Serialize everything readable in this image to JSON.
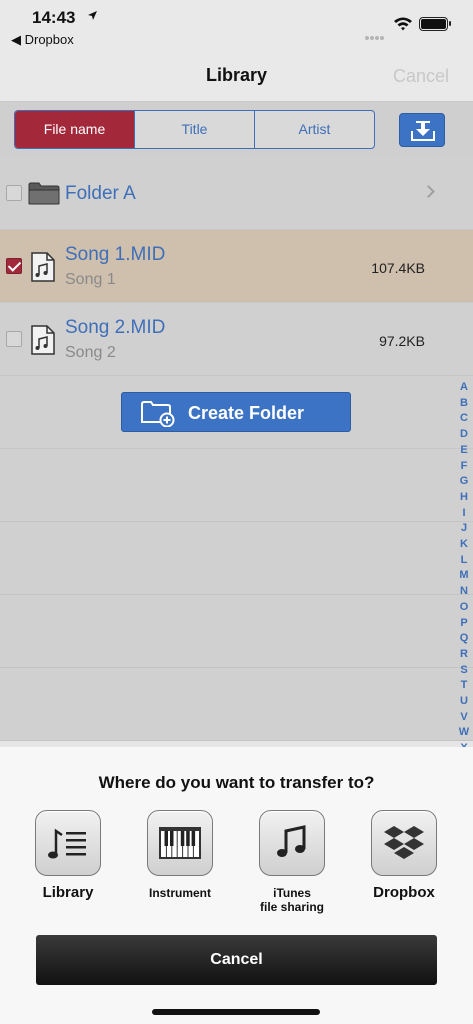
{
  "status": {
    "time": "14:43",
    "back_label": "Dropbox"
  },
  "nav": {
    "title": "Library",
    "cancel": "Cancel"
  },
  "segments": [
    "File name",
    "Title",
    "Artist"
  ],
  "rows": [
    {
      "name": "Folder A"
    },
    {
      "name": "Song 1.MID",
      "sub": "Song 1",
      "size": "107.4KB"
    },
    {
      "name": "Song 2.MID",
      "sub": "Song 2",
      "size": "97.2KB"
    }
  ],
  "create_folder": "Create Folder",
  "index": [
    "A",
    "B",
    "C",
    "D",
    "E",
    "F",
    "G",
    "H",
    "I",
    "J",
    "K",
    "L",
    "M",
    "N",
    "O",
    "P",
    "Q",
    "R",
    "S",
    "T",
    "U",
    "V",
    "W",
    "X"
  ],
  "sheet": {
    "question": "Where do you want to transfer to?",
    "options": [
      {
        "label": "Library",
        "icon": "library-icon"
      },
      {
        "label": "Instrument",
        "icon": "piano-keyboard-icon"
      },
      {
        "label": "iTunes\nfile sharing",
        "icon": "music-note-icon"
      },
      {
        "label": "Dropbox",
        "icon": "dropbox-icon"
      }
    ],
    "cancel": "Cancel"
  },
  "colors": {
    "accent": "#3f6fb8",
    "selected": "#a3283a"
  }
}
